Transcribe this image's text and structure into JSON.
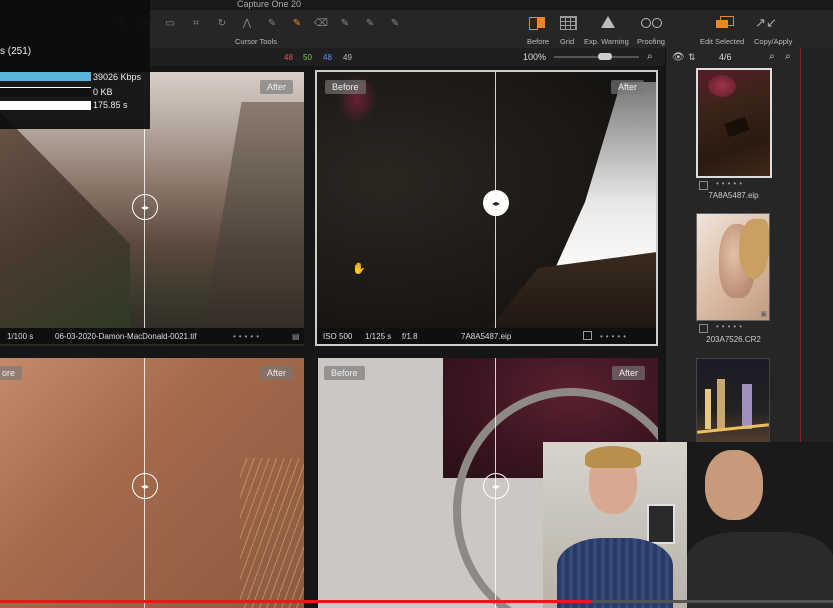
{
  "app": {
    "title": "Capture One 20"
  },
  "toolbar": {
    "cursor_tools_label": "Cursor Tools",
    "right_tools": [
      {
        "label": "Before",
        "icon": "before-compare-icon"
      },
      {
        "label": "Grid",
        "icon": "grid-icon"
      },
      {
        "label": "Exp. Warning",
        "icon": "warning-icon"
      },
      {
        "label": "Proofing",
        "icon": "proofing-glasses-icon"
      },
      {
        "label": "Edit Selected",
        "icon": "edit-selected-icon"
      },
      {
        "label": "Copy/Apply",
        "icon": "copy-apply-icon"
      }
    ]
  },
  "counts": {
    "red": "48",
    "green": "50",
    "blue": "48",
    "gray": "49"
  },
  "zoom": "100%",
  "filmstrip": {
    "position": "4/6",
    "items": [
      "7A8A5487.eip",
      "203A7526.CR2"
    ]
  },
  "overlay": {
    "title": "s (251)",
    "stats": [
      "39026 Kbps",
      "0 KB",
      "175.85 s"
    ],
    "stat_fill": [
      0.61,
      0.07,
      0.61
    ]
  },
  "viewer": {
    "before_label": "Before",
    "after_label": "After",
    "tiles": [
      {
        "before": "",
        "after": "After",
        "info": {
          "shutter": "1/100 s",
          "filename": "06-03-2020-Damon-MacDonald-0021.tif"
        }
      },
      {
        "before": "Before",
        "after": "After",
        "info": {
          "iso": "ISO 500",
          "shutter": "1/125 s",
          "aperture": "f/1.8",
          "filename": "7A8A5487.eip"
        }
      },
      {
        "before": "ore",
        "after": "After"
      },
      {
        "before": "Before",
        "after": "After"
      }
    ]
  },
  "video": {
    "progress": 0.71
  },
  "colors": {
    "accent": "#e8882a",
    "red": "#e05a5a",
    "green": "#7ac943",
    "blue": "#6b8cff",
    "progress": "#e41b17"
  }
}
